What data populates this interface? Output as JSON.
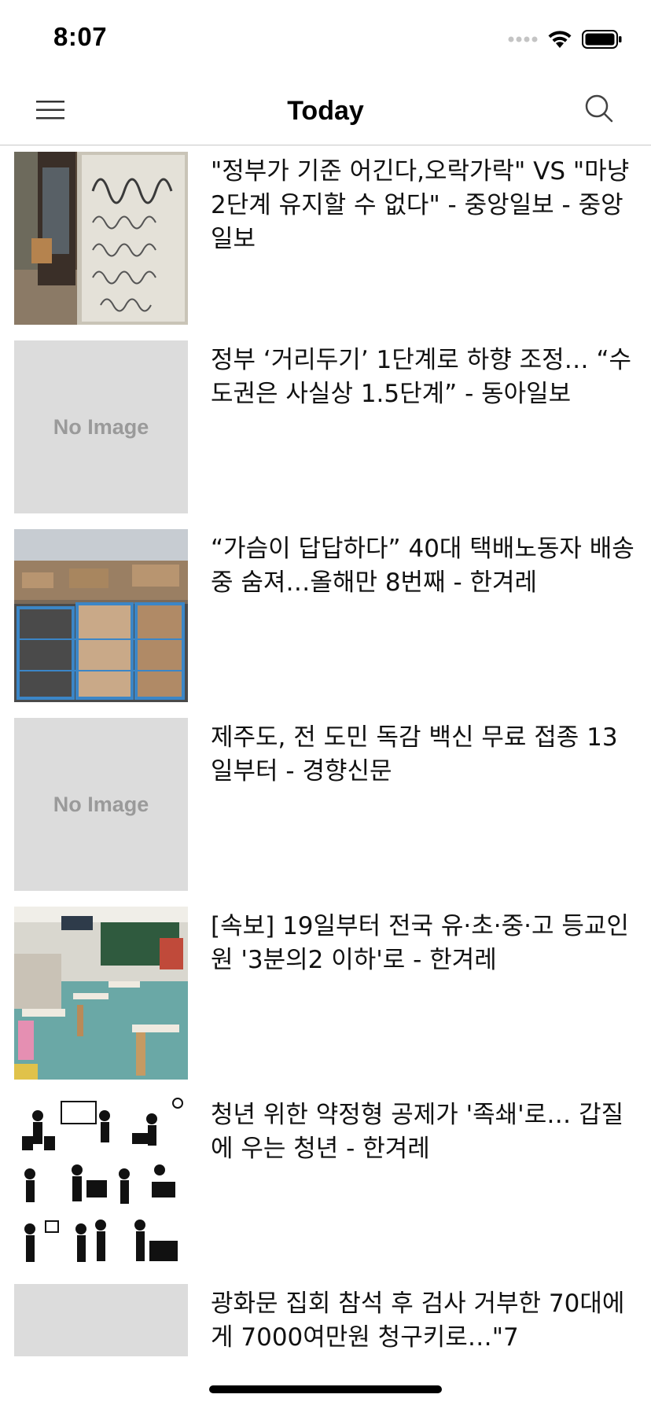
{
  "status_bar": {
    "time": "8:07"
  },
  "nav": {
    "title": "Today"
  },
  "articles": [
    {
      "headline": "\"정부가 기준 어긴다,오락가락\" VS \"마냥 2단계 유지할 수 없다\" - 중앙일보 - 중앙일보",
      "thumb": "photo-sign"
    },
    {
      "headline": "정부 ‘거리두기’ 1단계로 하향 조정… “수도권은 사실상 1.5단계” - 동아일보",
      "thumb": "no-image"
    },
    {
      "headline": "“가슴이 답답하다” 40대 택배노동자 배송중 숨져…올해만 8번째 - 한겨레",
      "thumb": "photo-boxes"
    },
    {
      "headline": "제주도, 전 도민 독감 백신 무료 접종 13일부터 - 경향신문",
      "thumb": "no-image"
    },
    {
      "headline": "[속보] 19일부터 전국 유·초·중·고 등교인원 '3분의2 이하'로 - 한겨레",
      "thumb": "photo-classroom"
    },
    {
      "headline": "청년 위한 약정형 공제가 '족쇄'로… 갑질에 우는 청년 - 한겨레",
      "thumb": "pictogram-workplace"
    },
    {
      "headline": "광화문 집회 참석 후 검사 거부한 70대에게 7000여만원 청구키로…\"7",
      "thumb": "blank-gray"
    }
  ],
  "no_image_label": "No Image"
}
